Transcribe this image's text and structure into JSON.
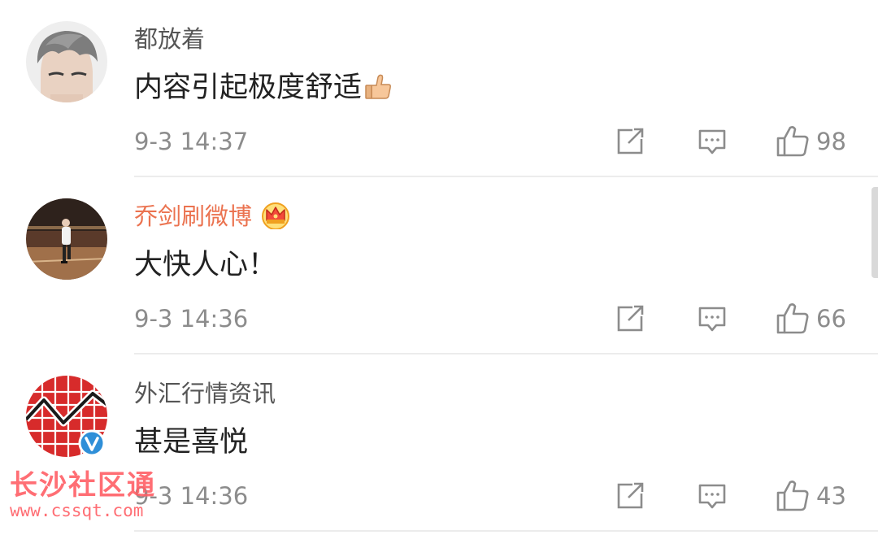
{
  "comments": [
    {
      "username": "都放着",
      "text": "内容引起极度舒适",
      "emoji": "thumbs-up-emoji",
      "time": "9-3 14:37",
      "likes": "98",
      "avatar": "man-with-gray-hair-avatar"
    },
    {
      "username": "乔剑刷微博",
      "text": "大快人心！",
      "badge": "vip-crown-badge",
      "time": "9-3 14:36",
      "likes": "66",
      "avatar": "basketball-court-player-avatar"
    },
    {
      "username": "外汇行情资讯",
      "text": "甚是喜悦",
      "badge": "verified-v-badge",
      "time": "9-3 14:36",
      "likes": "43",
      "avatar": "forex-chart-logo-avatar"
    }
  ],
  "icons": {
    "forward": "forward-icon",
    "reply": "comment-icon",
    "like": "like-icon"
  },
  "colors": {
    "vip_username": "#eb7350",
    "username": "#555555",
    "meta": "#8c8c8c",
    "verified_badge": "#2f8fd8",
    "watermark": "#ff5f66"
  },
  "watermark": {
    "title": "长沙社区通",
    "url": "www.cssqt.com"
  }
}
